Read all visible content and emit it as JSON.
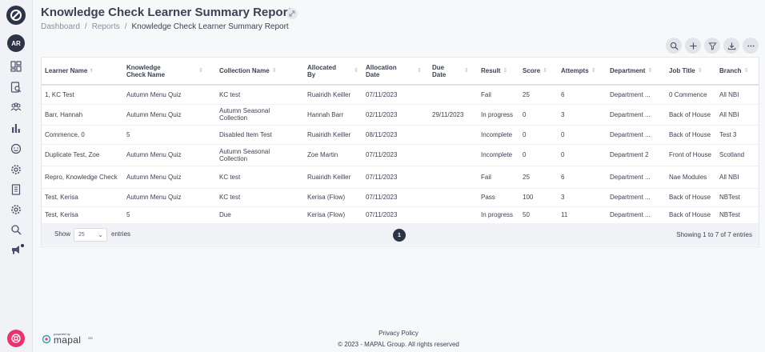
{
  "sidebar": {
    "avatar_initials": "AR",
    "icons": [
      "dashboard-icon",
      "document-search-icon",
      "team-icon",
      "chart-icon",
      "smiley-icon",
      "gear-icon",
      "building-icon",
      "settings-icon",
      "search-icon",
      "megaphone-icon"
    ]
  },
  "header": {
    "title": "Knowledge Check Learner Summary Report",
    "breadcrumb": [
      "Dashboard",
      "Reports",
      "Knowledge Check Learner Summary Report"
    ]
  },
  "toolbar": {
    "icons": [
      "search-icon",
      "add-icon",
      "filter-icon",
      "download-icon",
      "more-icon"
    ]
  },
  "table": {
    "columns": [
      {
        "label": "Learner Name",
        "sort": "↑"
      },
      {
        "label": "Knowledge Check Name",
        "sort": "⇕"
      },
      {
        "label": "Collection Name",
        "sort": "⇕"
      },
      {
        "label": "Allocated By",
        "sort": "⇕"
      },
      {
        "label": "Allocation Date",
        "sort": "⇕"
      },
      {
        "label": "Due Date",
        "sort": "⇕"
      },
      {
        "label": "Result",
        "sort": "⇕"
      },
      {
        "label": "Score",
        "sort": "⇕"
      },
      {
        "label": "Attempts",
        "sort": "⇕"
      },
      {
        "label": "Department",
        "sort": "⇕"
      },
      {
        "label": "Job Title",
        "sort": "⇕"
      },
      {
        "label": "Branch",
        "sort": "⇕"
      }
    ],
    "rows": [
      [
        "1, KC Test",
        "Autumn Menu Quiz",
        "KC test",
        "Ruairidh Keiller",
        "07/11/2023",
        "",
        "Fail",
        "25",
        "6",
        "Department ...",
        "0 Commence",
        "All NBI"
      ],
      [
        "Barr, Hannah",
        "Autumn Menu Quiz",
        "Autumn Seasonal Collection",
        "Hannah Barr",
        "02/11/2023",
        "29/11/2023",
        "In progress",
        "0",
        "3",
        "Department ...",
        "Back of House",
        "All NBI"
      ],
      [
        "Commence, 0",
        "5",
        "Disabled Item Test",
        "Ruairidh Keiller",
        "08/11/2023",
        "",
        "Incomplete",
        "0",
        "0",
        "Department ...",
        "Back of House",
        "Test 3"
      ],
      [
        "Duplicate Test, Zoe",
        "Autumn Menu Quiz",
        "Autumn Seasonal Collection",
        "Zoe Martin",
        "07/11/2023",
        "",
        "Incomplete",
        "0",
        "0",
        "Department 2",
        "Front of House",
        "Scotland"
      ],
      [
        "Repro, Knowledge Check",
        "Autumn Menu Quiz",
        "KC test",
        "Ruairidh Keiller",
        "07/11/2023",
        "",
        "Fail",
        "25",
        "6",
        "Department ...",
        "Nae Modules",
        "All NBI"
      ],
      [
        "Test, Kerisa",
        "Autumn Menu Quiz",
        "KC test",
        "Kerisa (Flow)",
        "07/11/2023",
        "",
        "Pass",
        "100",
        "3",
        "Department ...",
        "Back of House",
        "NBTest"
      ],
      [
        "Test, Kerisa",
        "5",
        "Due",
        "Kerisa (Flow)",
        "07/11/2023",
        "",
        "In progress",
        "50",
        "11",
        "Department ...",
        "Back of House",
        "NBTest"
      ]
    ]
  },
  "footer": {
    "show_label": "Show",
    "page_size": "25",
    "entries_label": "entries",
    "current_page": "1",
    "showing_text": "Showing 1 to 7 of 7 entries"
  },
  "page_footer": {
    "powered_by": "powered by",
    "brand": "mapal",
    "brand_suffix": "OS",
    "privacy": "Privacy Policy",
    "copyright": "© 2023 - MAPAL Group. All rights reserved"
  },
  "colors": {
    "primary_dark": "#2c3446",
    "help_accent": "#e8336d"
  }
}
